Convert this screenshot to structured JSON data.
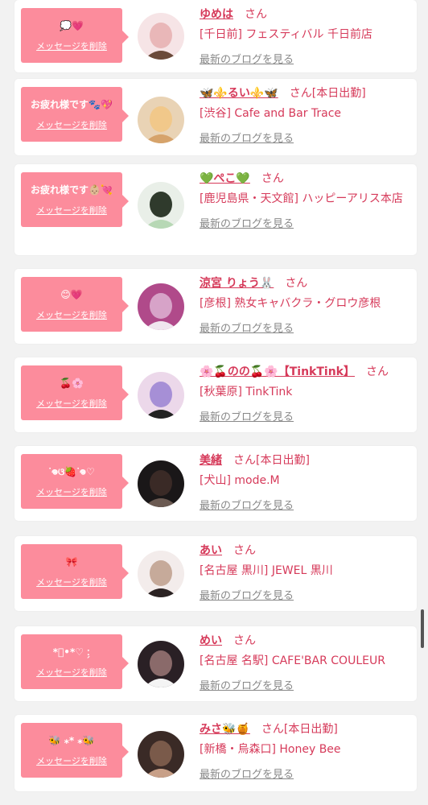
{
  "colors": {
    "accent_pink": "#fc8c9c",
    "name_pink": "#d63a5a",
    "link_gray": "#888888"
  },
  "cards": [
    {
      "message": "💭💗",
      "delete_label": "メッセージを削除",
      "name": "ゆめは",
      "suffix": "さん",
      "status": "",
      "shop": "[千日前] フェスティバル 千日前店",
      "blog_label": "最新のブログを見る",
      "avatar_icon": "profile-photo"
    },
    {
      "message": "お疲れ様です🐾💖",
      "delete_label": "メッセージを削除",
      "name": "🦋⚜️るい⚜️🦋",
      "suffix": "さん",
      "status": "[本日出勤]",
      "shop": "[渋谷] Cafe and Bar Trace",
      "blog_label": "最新のブログを見る",
      "avatar_icon": "profile-photo"
    },
    {
      "message": "お疲れ様です👶🏼💘",
      "delete_label": "メッセージを削除",
      "name": "💚ぺこ💚",
      "suffix": "さん",
      "status": "",
      "shop": "[鹿児島県・天文館] ハッピーアリス本店",
      "blog_label": "最新のブログを見る",
      "avatar_icon": "profile-photo"
    },
    {
      "message": "😊💗",
      "delete_label": "メッセージを削除",
      "name": "涼宮 りょう🐰",
      "suffix": "さん",
      "status": "",
      "shop": "[彦根] 熟女キャバクラ・グロウ彦根",
      "blog_label": "最新のブログを見る",
      "avatar_icon": "shop-logo"
    },
    {
      "message": "🍒🌸",
      "delete_label": "メッセージを削除",
      "name": "🌸🍒のの🍒🌸【TinkTink】",
      "suffix": "さん",
      "status": "",
      "shop": "[秋葉原] TinkTink",
      "blog_label": "最新のブログを見る",
      "avatar_icon": "profile-photo"
    },
    {
      "message": "ᐝ𖦹ଓ🍓ᐝ𖦹♡",
      "delete_label": "メッセージを削除",
      "name": "美緒",
      "suffix": "さん",
      "status": "[本日出勤]",
      "shop": "[犬山] mode.M",
      "blog_label": "最新のブログを見る",
      "avatar_icon": "profile-photo"
    },
    {
      "message": "🎀",
      "delete_label": "メッセージを削除",
      "name": "あい",
      "suffix": "さん",
      "status": "",
      "shop": "[名古屋 黒川] JEWEL 黒川",
      "blog_label": "最新のブログを見る",
      "avatar_icon": "profile-photo"
    },
    {
      "message": "*ﾟ•*♡ ː̗",
      "delete_label": "メッセージを削除",
      "name": "めい",
      "suffix": "さん",
      "status": "",
      "shop": "[名古屋 名駅] CAFE'BAR COULEUR",
      "blog_label": "最新のブログを見る",
      "avatar_icon": "profile-photo"
    },
    {
      "message": "🐝 ⁎* ⁎🐝",
      "delete_label": "メッセージを削除",
      "name": "みさ🐝🍯",
      "suffix": "さん",
      "status": "[本日出勤]",
      "shop": "[新橋・烏森口] Honey Bee",
      "blog_label": "最新のブログを見る",
      "avatar_icon": "profile-photo"
    }
  ]
}
